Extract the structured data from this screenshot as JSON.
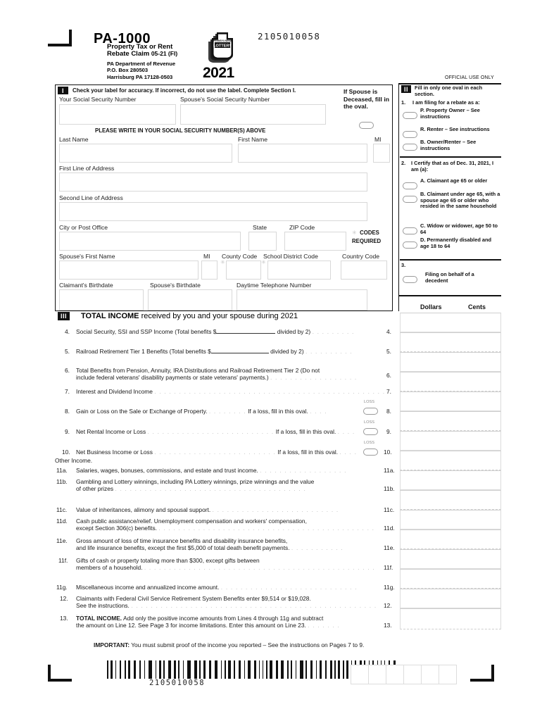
{
  "document": {
    "form_number": "PA-1000",
    "title_line1": "Property Tax or Rent",
    "title_line2": "Rebate Claim",
    "revision": "05-21 (FI)",
    "agency": "PA Department of Revenue",
    "po_box": "P.O. Box 280503",
    "city_state_zip": "Harrisburg PA 17128-0503",
    "tax_year": "2021",
    "doc_number": "2105010058",
    "official_use": "OFFICIAL USE ONLY",
    "logo_text_top": "PENNSYLVANIA",
    "logo_text_main": "LOTTERY"
  },
  "section_one": {
    "badge": "I",
    "instruction": "Check your label for accuracy. If incorrect, do not use the label. Complete Section I.",
    "ssn_label": "Your Social Security Number",
    "spouse_ssn_label": "Spouse's Social Security Number",
    "write_ssn_note": "PLEASE WRITE IN YOUR SOCIAL SECURITY NUMBER(S) ABOVE",
    "spouse_deceased_note": "If Spouse is Deceased, fill in the oval.",
    "fields": {
      "last_name": "Last Name",
      "first_name": "First Name",
      "mi": "MI",
      "address_line1": "First Line of Address",
      "address_line2": "Second Line of Address",
      "city": "City or Post Office",
      "state": "State",
      "zip": "ZIP Code",
      "codes_required": "CODES REQUIRED",
      "spouse_first_name": "Spouse's First Name",
      "spouse_mi": "MI",
      "county_code": "County Code",
      "school_district_code": "School District Code",
      "country_code": "Country Code",
      "claimant_birthdate": "Claimant's Birthdate",
      "spouse_birthdate": "Spouse's Birthdate",
      "daytime_phone": "Daytime Telephone Number"
    }
  },
  "section_two": {
    "badge": "II",
    "heading": "Fill in only one oval in each section.",
    "q1_number": "1.",
    "q1_text": "I am filing for a rebate as a:",
    "q1_options": [
      "P.  Property Owner – See instructions",
      "R.  Renter – See instructions",
      "B.  Owner/Renter – See instructions"
    ],
    "q2_number": "2.",
    "q2_text": "I Certify that as of Dec. 31, 2021, I am (a):",
    "q2_options": [
      "A. Claimant age 65 or older",
      "B. Claimant under age 65, with a spouse age 65 or older who resided in the same household",
      "C. Widow or widower, age 50 to 64",
      "D. Permanently disabled and age 18 to 64"
    ],
    "q3_number": "3.",
    "q3_option": "Filing on behalf of a decedent"
  },
  "section_three": {
    "badge": "III",
    "heading_bold": "TOTAL INCOME",
    "heading_rest": "received by you and your spouse during 2021",
    "columns": {
      "dollars": "Dollars",
      "cents": "Cents"
    },
    "other_income_label": "Other Income.",
    "loss_label": "LOSS",
    "loss_note": "If a loss, fill in this oval.",
    "lines": [
      {
        "no": "4.",
        "ref": "4.",
        "text_a": "Social Security, SSI and SSP Income (Total benefits $",
        "text_b": "divided by 2)",
        "has_blank": true,
        "has_loss": false
      },
      {
        "no": "5.",
        "ref": "5.",
        "text_a": "Railroad Retirement Tier 1 Benefits (Total benefits $",
        "text_b": "divided by 2)",
        "has_blank": true,
        "has_loss": false
      },
      {
        "no": "6.",
        "ref": "6.",
        "text_a": "Total Benefits from Pension, Annuity, IRA Distributions and Railroad Retirement Tier 2 (Do not",
        "text_b": "include federal veterans' disability payments or state veterans' payments.)",
        "has_blank": false,
        "has_loss": false
      },
      {
        "no": "7.",
        "ref": "7.",
        "text_a": "Interest and Dividend Income",
        "text_b": "",
        "has_blank": false,
        "has_loss": false
      },
      {
        "no": "8.",
        "ref": "8.",
        "text_a": "Gain or Loss on the Sale or Exchange of Property.",
        "text_b": "",
        "has_blank": false,
        "has_loss": true
      },
      {
        "no": "9.",
        "ref": "9.",
        "text_a": "Net Rental Income or Loss",
        "text_b": "",
        "has_blank": false,
        "has_loss": true
      },
      {
        "no": "10.",
        "ref": "10.",
        "text_a": "Net Business Income or Loss",
        "text_b": "",
        "has_blank": false,
        "has_loss": true
      },
      {
        "no": "11a.",
        "ref": "11a.",
        "text_a": "Salaries, wages, bonuses, commissions, and estate and trust income.",
        "text_b": "",
        "has_blank": false,
        "has_loss": false
      },
      {
        "no": "11b.",
        "ref": "11b.",
        "text_a": "Gambling and Lottery winnings, including PA Lottery winnings, prize winnings and the value",
        "text_b": "of other prizes",
        "has_blank": false,
        "has_loss": false
      },
      {
        "no": "11c.",
        "ref": "11c.",
        "text_a": "Value of inheritances, alimony and spousal support.",
        "text_b": "",
        "has_blank": false,
        "has_loss": false
      },
      {
        "no": "11d.",
        "ref": "11d.",
        "text_a": "Cash public assistance/relief. Unemployment compensation and workers' compensation,",
        "text_b": "except Section 306(c) benefits.",
        "has_blank": false,
        "has_loss": false
      },
      {
        "no": "11e.",
        "ref": "11e.",
        "text_a": "Gross amount of loss of time insurance benefits and disability insurance benefits,",
        "text_b": "and life insurance benefits, except the first $5,000 of total death benefit payments.",
        "has_blank": false,
        "has_loss": false
      },
      {
        "no": "11f.",
        "ref": "11f.",
        "text_a": "Gifts of cash or property totaling more than $300, except gifts between",
        "text_b": "members of a household.",
        "has_blank": false,
        "has_loss": false
      },
      {
        "no": "11g.",
        "ref": "11g.",
        "text_a": "Miscellaneous income and annualized income amount.",
        "text_b": "",
        "has_blank": false,
        "has_loss": false
      },
      {
        "no": "12.",
        "ref": "12.",
        "text_a": "Claimants with Federal Civil Service Retirement System Benefits enter $9,514 or $19,028.",
        "text_b": "See the instructions.",
        "has_blank": false,
        "has_loss": false
      },
      {
        "no": "13.",
        "ref": "13.",
        "text_a": "TOTAL INCOME. Add only the positive income amounts from Lines 4 through 11g and subtract",
        "text_b": "the amount on Line 12. See Page 3 for income limitations. Enter this amount on Line 23.",
        "has_blank": false,
        "has_loss": false,
        "bold_prefix": "TOTAL INCOME."
      }
    ]
  },
  "footer": {
    "important_bold": "IMPORTANT:",
    "important_text": " You must submit proof of the income you reported – See the instructions on Pages 7 to 9.",
    "barcode_number": "2105010058"
  }
}
